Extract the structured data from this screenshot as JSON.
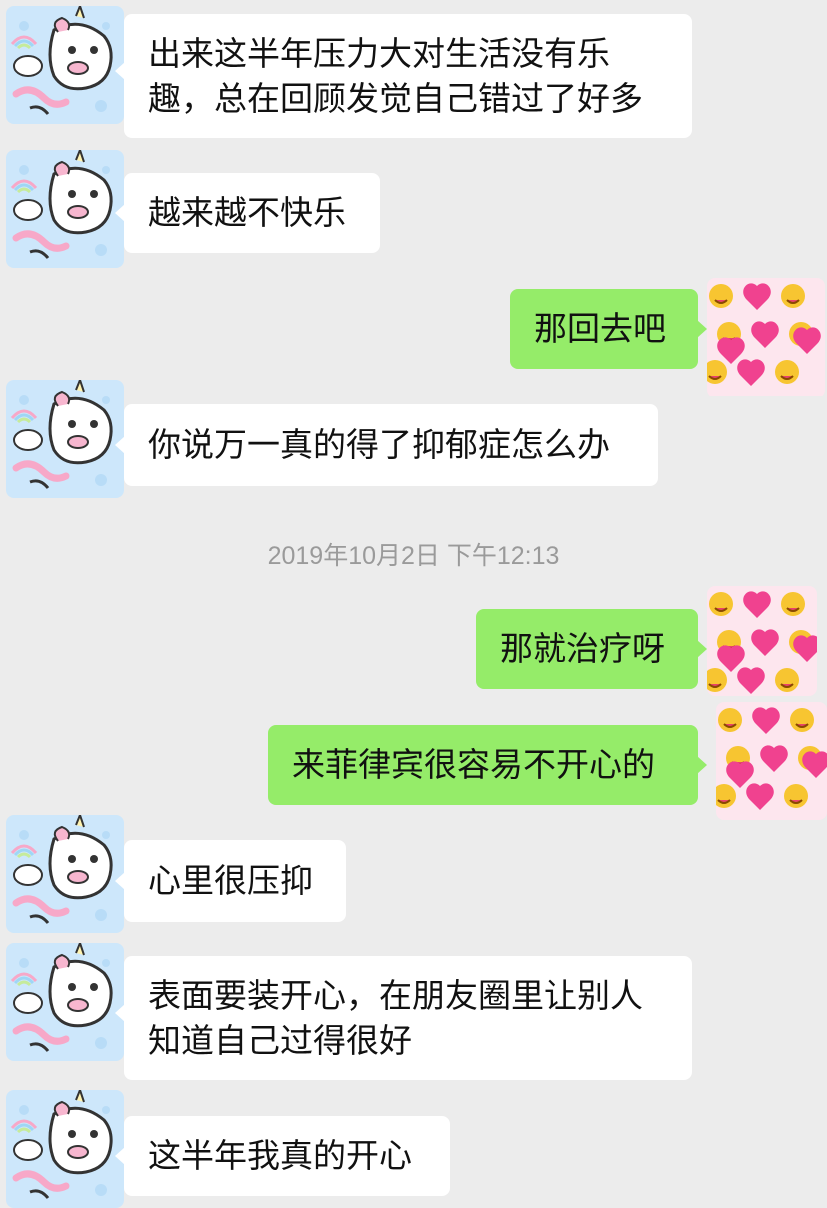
{
  "messages": [
    {
      "side": "in",
      "text": "出来这半年压力大对生活没有乐\n趣，总在回顾发觉自己错过了好多"
    },
    {
      "side": "in",
      "text": "越来越不快乐"
    },
    {
      "side": "out",
      "text": "那回去吧"
    },
    {
      "side": "in",
      "text": "你说万一真的得了抑郁症怎么办"
    },
    {
      "side": "out",
      "text": "那就治疗呀"
    },
    {
      "side": "out",
      "text": "来菲律宾很容易不开心的"
    },
    {
      "side": "in",
      "text": "心里很压抑"
    },
    {
      "side": "in",
      "text": "表面要装开心，在朋友圈里让别人\n知道自己过得很好"
    },
    {
      "side": "in",
      "text": "这半年我真的开心"
    }
  ],
  "timestamp": "2019年10月2日 下午12:13",
  "avatars": {
    "contact": "unicorn-avatar-icon",
    "self": "emoji-pattern-avatar-icon"
  },
  "colors": {
    "background": "#ececec",
    "incoming_bubble": "#ffffff",
    "outgoing_bubble": "#95ec69",
    "timestamp_text": "#9a9a9a"
  }
}
